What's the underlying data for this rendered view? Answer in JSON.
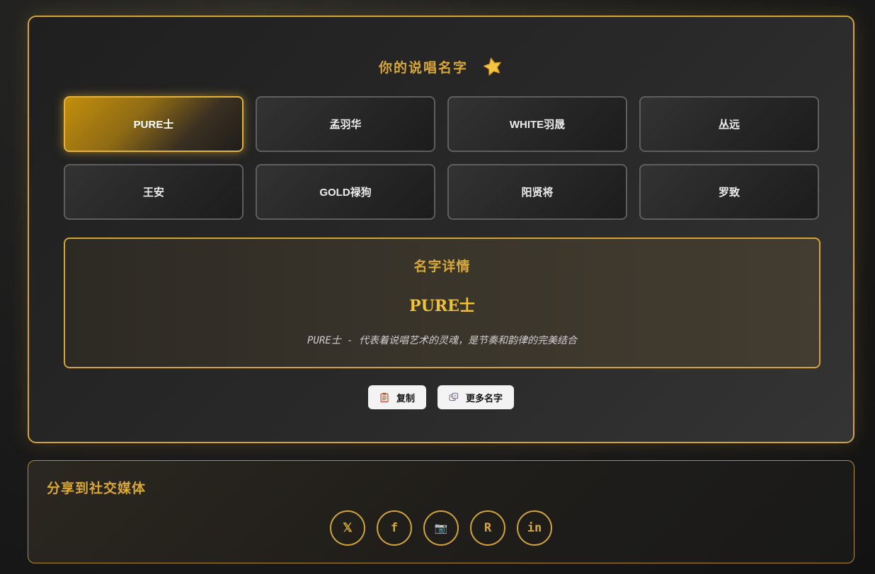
{
  "header": {
    "title": "你的说唱名字",
    "title_icon": "star-icon"
  },
  "names": [
    {
      "label": "PURE士",
      "active": true
    },
    {
      "label": "孟羽华",
      "active": false
    },
    {
      "label": "WHITE羽晟",
      "active": false
    },
    {
      "label": "丛远",
      "active": false
    },
    {
      "label": "王安",
      "active": false
    },
    {
      "label": "GOLD禄狗",
      "active": false
    },
    {
      "label": "阳贤将",
      "active": false
    },
    {
      "label": "罗致",
      "active": false
    }
  ],
  "detail": {
    "heading": "名字详情",
    "name": "PURE士",
    "description": "PURE士 - 代表着说唱艺术的灵魂，是节奏和韵律的完美结合"
  },
  "actions": {
    "copy_label": "复制",
    "more_label": "更多名字"
  },
  "share": {
    "title": "分享到社交媒体",
    "buttons": [
      {
        "label": "𝕏",
        "icon": "x-icon"
      },
      {
        "label": "f",
        "icon": "facebook-icon"
      },
      {
        "label": "📷",
        "icon": "camera-icon"
      },
      {
        "label": "R",
        "icon": "reddit-icon"
      },
      {
        "label": "in",
        "icon": "linkedin-icon"
      }
    ]
  },
  "colors": {
    "accent": "#d4a535",
    "accent_text": "#d9a833",
    "highlight_name": "#f0c232"
  }
}
